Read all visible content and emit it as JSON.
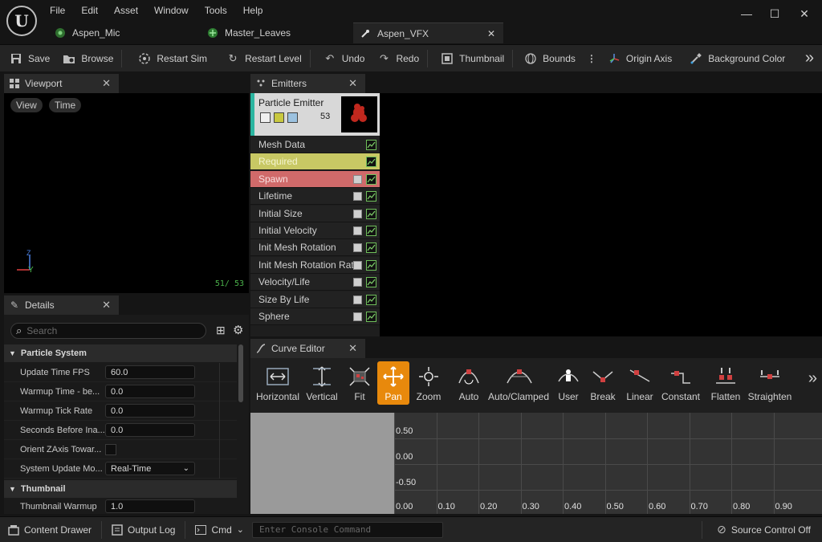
{
  "app": {
    "logo_glyph": "U",
    "menu": [
      "File",
      "Edit",
      "Asset",
      "Window",
      "Tools",
      "Help"
    ],
    "tabs": [
      {
        "label": "Aspen_Mic",
        "icon": "particle-icon"
      },
      {
        "label": "Master_Leaves",
        "icon": "material-icon"
      },
      {
        "label": "Aspen_VFX",
        "icon": "cascade-icon",
        "active": true
      }
    ],
    "window_controls": {
      "minimize": "—",
      "maximize": "☐",
      "close": "✕"
    }
  },
  "toolbar": {
    "save": "Save",
    "browse": "Browse",
    "restart_sim": "Restart Sim",
    "restart_level": "Restart Level",
    "undo": "Undo",
    "redo": "Redo",
    "thumbnail": "Thumbnail",
    "bounds": "Bounds",
    "origin_axis": "Origin Axis",
    "background_color": "Background Color",
    "overflow": "»"
  },
  "viewport": {
    "tab_label": "Viewport",
    "view_btn": "View",
    "time_btn": "Time",
    "axis_z": "Z",
    "axis_y": "Y",
    "particle_count": "51/ 53"
  },
  "details": {
    "tab_label": "Details",
    "search_placeholder": "Search",
    "categories": [
      {
        "name": "Particle System",
        "props": [
          {
            "label": "Update Time FPS",
            "value": "60.0"
          },
          {
            "label": "Warmup Time - be...",
            "value": "0.0"
          },
          {
            "label": "Warmup Tick Rate",
            "value": "0.0"
          },
          {
            "label": "Seconds Before Ina...",
            "value": "0.0"
          },
          {
            "label": "Orient ZAxis Towar...",
            "value": ""
          },
          {
            "label": "System Update Mo...",
            "value": "Real-Time"
          }
        ]
      },
      {
        "name": "Thumbnail",
        "props": [
          {
            "label": "Thumbnail Warmup",
            "value": "1.0"
          }
        ]
      }
    ]
  },
  "emitters": {
    "tab_label": "Emitters",
    "emitter_name": "Particle Emitter",
    "emitter_count": "53",
    "modules": [
      {
        "label": "Mesh Data",
        "checkbox": false,
        "style": "normal"
      },
      {
        "label": "Required",
        "checkbox": false,
        "style": "required"
      },
      {
        "label": "Spawn",
        "checkbox": true,
        "style": "spawn"
      },
      {
        "label": "Lifetime",
        "checkbox": true,
        "style": "normal"
      },
      {
        "label": "Initial Size",
        "checkbox": true,
        "style": "normal"
      },
      {
        "label": "Initial Velocity",
        "checkbox": true,
        "style": "normal"
      },
      {
        "label": "Init Mesh Rotation",
        "checkbox": true,
        "style": "normal"
      },
      {
        "label": "Init Mesh Rotation Rate",
        "checkbox": true,
        "style": "normal"
      },
      {
        "label": "Velocity/Life",
        "checkbox": true,
        "style": "normal"
      },
      {
        "label": "Size By Life",
        "checkbox": true,
        "style": "normal"
      },
      {
        "label": "Sphere",
        "checkbox": true,
        "style": "normal"
      }
    ],
    "colors": {
      "required": "#c8c864",
      "spawn": "#d06a6a",
      "emitter_accent": "#2ab5a0"
    }
  },
  "curve_editor": {
    "tab_label": "Curve Editor",
    "buttons": [
      "Horizontal",
      "Vertical",
      "Fit",
      "Pan",
      "Zoom",
      "Auto",
      "Auto/Clamped",
      "User",
      "Break",
      "Linear",
      "Constant",
      "Flatten",
      "Straighten"
    ],
    "active_button": "Pan",
    "overflow": "»",
    "y_labels": [
      "0.50",
      "0.00",
      "-0.50"
    ],
    "x_labels": [
      "0.00",
      "0.10",
      "0.20",
      "0.30",
      "0.40",
      "0.50",
      "0.60",
      "0.70",
      "0.80",
      "0.90"
    ]
  },
  "bottombar": {
    "content_drawer": "Content Drawer",
    "output_log": "Output Log",
    "cmd": "Cmd",
    "console_placeholder": "Enter Console Command",
    "source_control": "Source Control Off"
  }
}
